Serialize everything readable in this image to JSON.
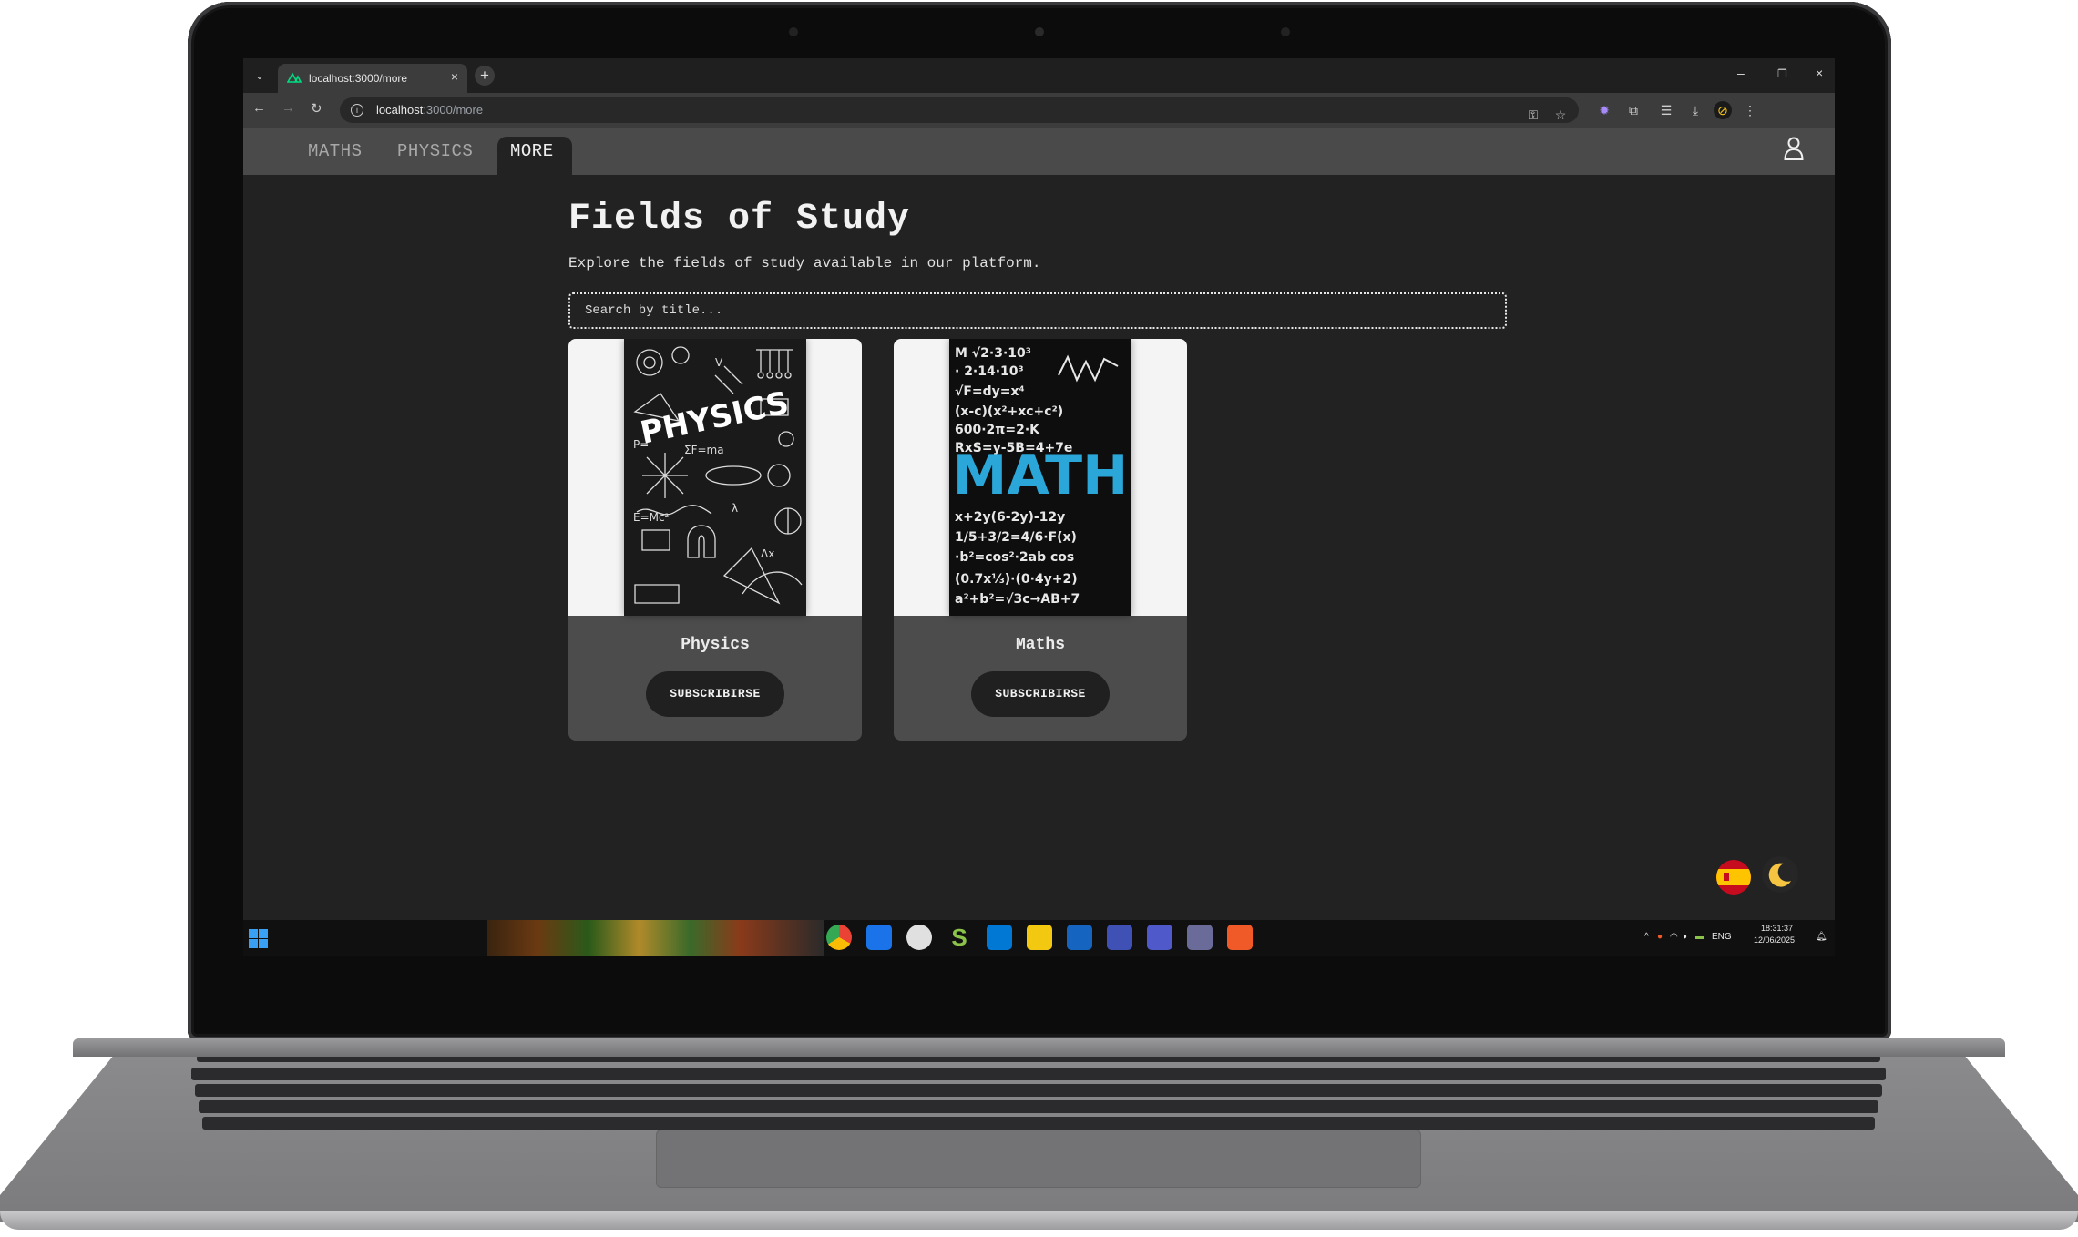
{
  "browser": {
    "tab_title": "localhost:3000/more",
    "tab_close": "×",
    "new_tab": "+",
    "url_host": "localhost",
    "url_path": ":3000/more",
    "window_controls": [
      "–",
      "❐",
      "×"
    ]
  },
  "site": {
    "nav": [
      {
        "label": "MATHS",
        "active": false
      },
      {
        "label": "PHYSICS",
        "active": false
      },
      {
        "label": "MORE",
        "active": true
      }
    ],
    "title": "Fields of Study",
    "subtitle": "Explore the fields of study available in our platform.",
    "search": {
      "placeholder": "Search by title...",
      "value": ""
    },
    "cards": [
      {
        "name": "Physics",
        "button": "SUBSCRIBIRSE",
        "image_word": "PHYSICS"
      },
      {
        "name": "Maths",
        "button": "SUBSCRIBIRSE",
        "image_word": "MATH"
      }
    ],
    "icons": [
      "user-icon",
      "spain-flag-icon",
      "moon-icon"
    ]
  },
  "taskbar": {
    "language": "ENG",
    "time": "18:31:37",
    "date": "12/06/2025"
  },
  "colors": {
    "page_bg": "#222222",
    "nav_bg": "#4a4a4a",
    "card_bg": "#4c4c4c",
    "button_bg": "#202020",
    "math_word": "#2aa7d8"
  }
}
